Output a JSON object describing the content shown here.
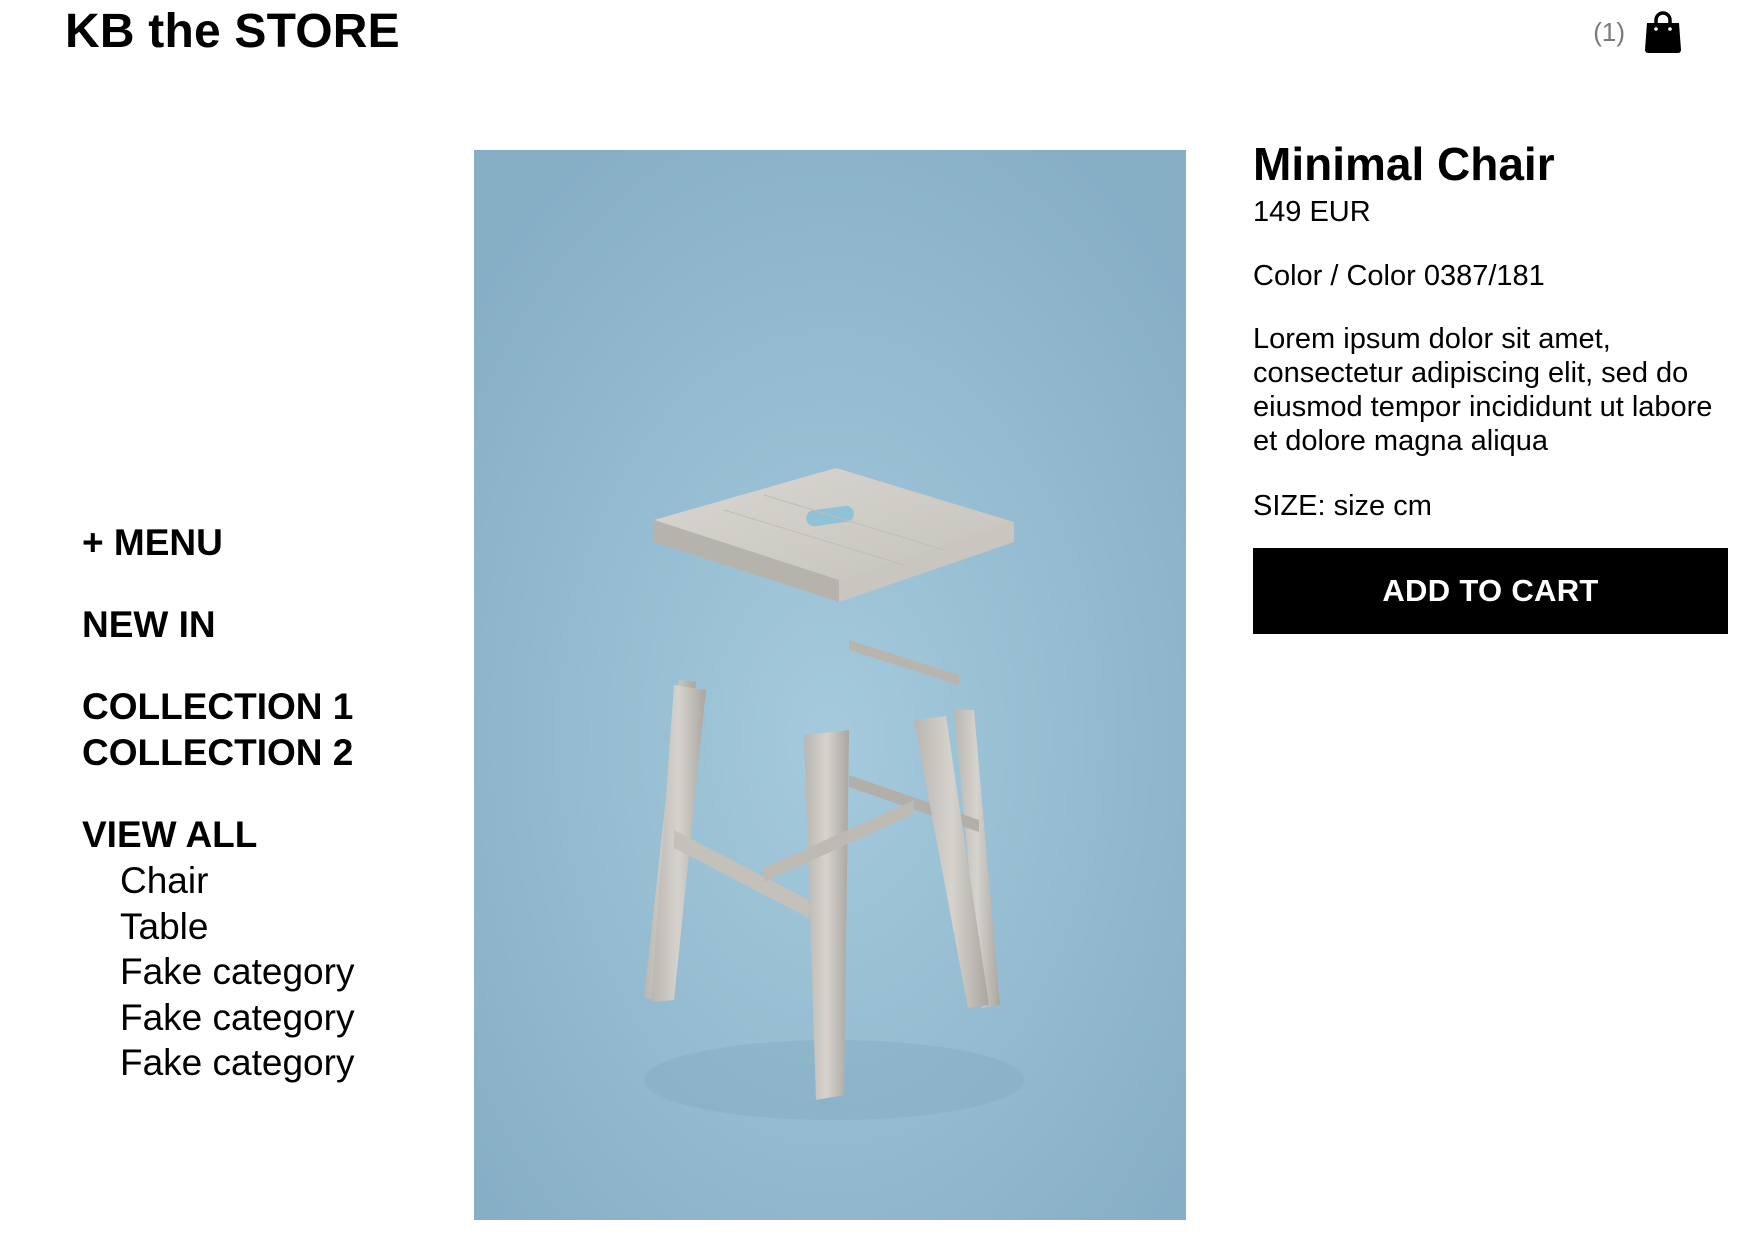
{
  "header": {
    "logo": "KB the STORE",
    "cart_count": "(1)",
    "cart_icon": "shopping-bag-icon"
  },
  "nav": {
    "menu": "+ MENU",
    "new_in": "NEW IN",
    "collections": [
      "COLLECTION 1",
      "COLLECTION 2"
    ],
    "view_all": "VIEW ALL",
    "categories": [
      "Chair",
      "Table",
      "Fake category",
      "Fake category",
      "Fake category"
    ]
  },
  "product": {
    "image_subject": "wooden-bar-stool",
    "image_bg_color": "#8fb8cf",
    "title": "Minimal Chair",
    "price": "149 EUR",
    "color": "Color / Color 0387/181",
    "description": "Lorem ipsum dolor sit amet, consectetur adipiscing elit, sed do eiusmod tempor incididunt ut labore et dolore magna aliqua",
    "size": "SIZE: size cm",
    "add_to_cart": "ADD TO CART"
  },
  "colors": {
    "button_bg": "#000000",
    "button_text": "#ffffff",
    "cart_count_text": "#7a7a7a"
  }
}
